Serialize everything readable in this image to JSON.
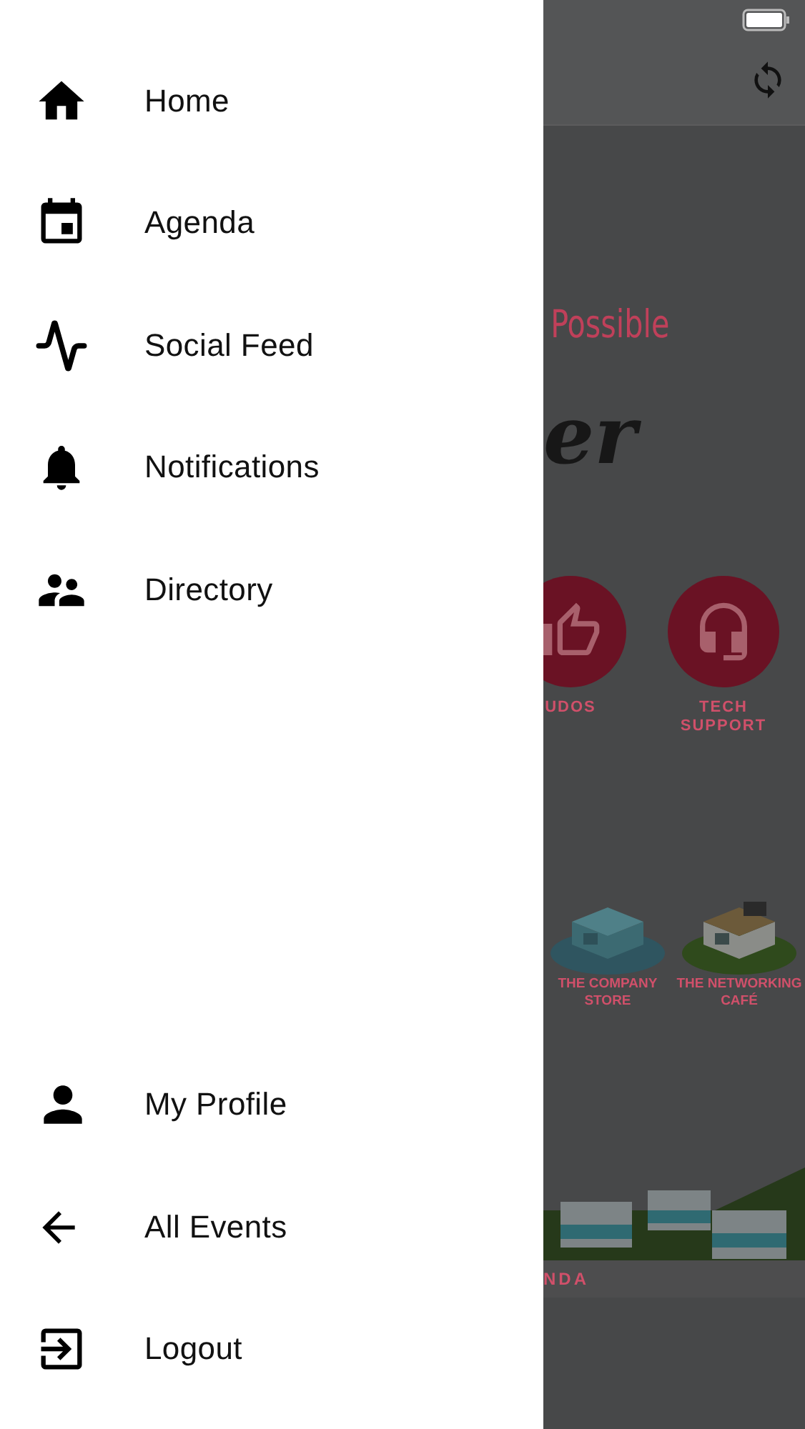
{
  "drawer": {
    "items": [
      {
        "kind": "home",
        "label": "Home"
      },
      {
        "kind": "calendar",
        "label": "Agenda"
      },
      {
        "kind": "pulse",
        "label": "Social Feed"
      },
      {
        "kind": "bell",
        "label": "Notifications"
      },
      {
        "kind": "people",
        "label": "Directory"
      }
    ],
    "bottom_items": [
      {
        "kind": "person",
        "label": "My Profile"
      },
      {
        "kind": "back",
        "label": "All Events"
      },
      {
        "kind": "exit",
        "label": "Logout"
      }
    ]
  },
  "background": {
    "tagline": "Possible",
    "script": "er",
    "tiles": [
      {
        "kind": "thumb",
        "label": "UDOS"
      },
      {
        "kind": "headset",
        "label": "TECH SUPPORT"
      }
    ],
    "venues": [
      {
        "kind": "store",
        "label": "THE COMPANY STORE"
      },
      {
        "kind": "cafe",
        "label": "THE NETWORKING CAFÉ"
      }
    ],
    "banner_label": "NDA"
  }
}
